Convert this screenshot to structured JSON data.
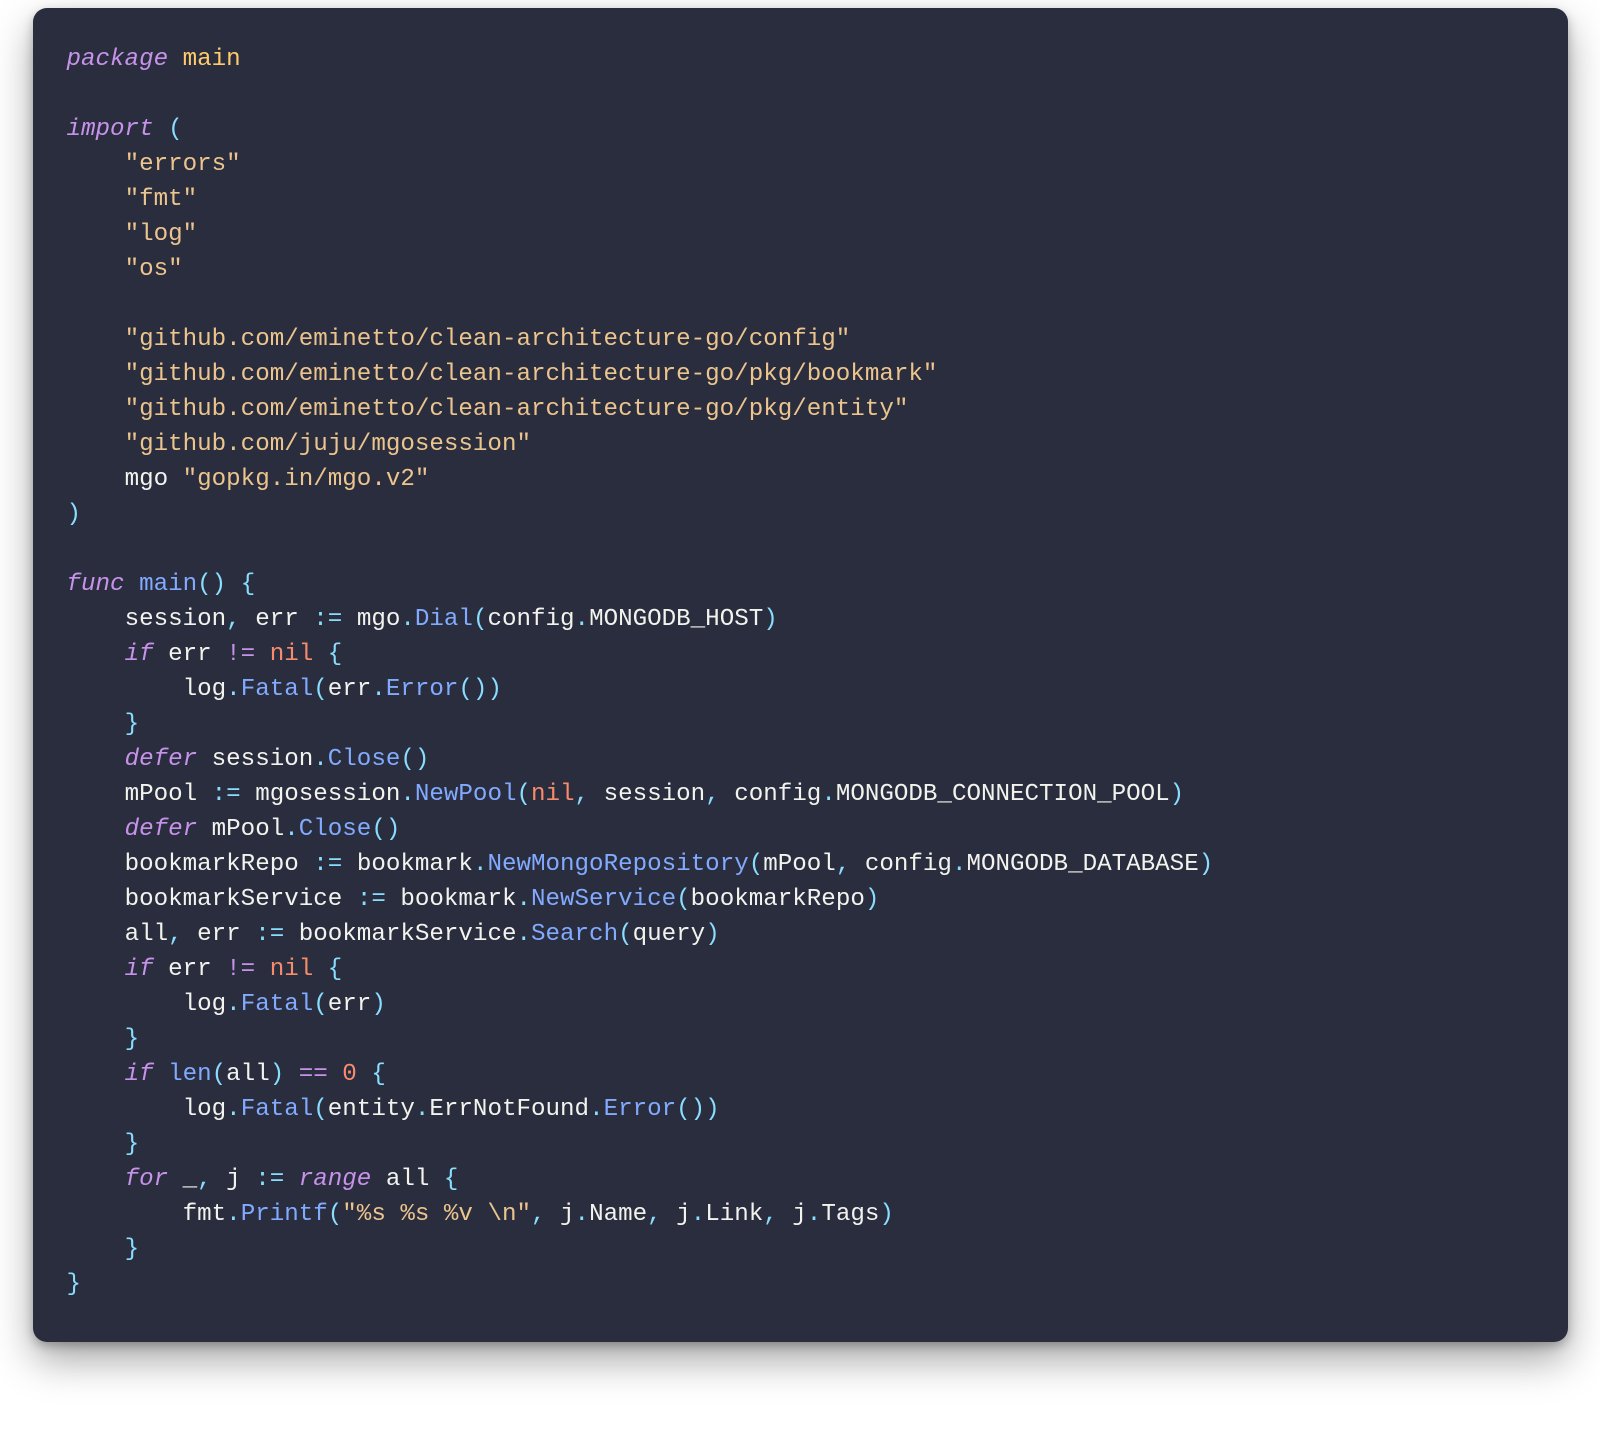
{
  "code": {
    "l1": {
      "a": "package",
      "b": " ",
      "c": "main"
    },
    "l2": "",
    "l3": {
      "a": "import",
      "b": " ",
      "c": "("
    },
    "l4": {
      "pad": "    ",
      "s": "\"errors\""
    },
    "l5": {
      "pad": "    ",
      "s": "\"fmt\""
    },
    "l6": {
      "pad": "    ",
      "s": "\"log\""
    },
    "l7": {
      "pad": "    ",
      "s": "\"os\""
    },
    "l8": "",
    "l9": {
      "pad": "    ",
      "s": "\"github.com/eminetto/clean-architecture-go/config\""
    },
    "l10": {
      "pad": "    ",
      "s": "\"github.com/eminetto/clean-architecture-go/pkg/bookmark\""
    },
    "l11": {
      "pad": "    ",
      "s": "\"github.com/eminetto/clean-architecture-go/pkg/entity\""
    },
    "l12": {
      "pad": "    ",
      "s": "\"github.com/juju/mgosession\""
    },
    "l13": {
      "pad": "    ",
      "a": "mgo",
      "b": " ",
      "s": "\"gopkg.in/mgo.v2\""
    },
    "l14": {
      "c": ")"
    },
    "l15": "",
    "l16": {
      "a": "func",
      "sp": " ",
      "b": "main",
      "c": "()",
      "sp2": " ",
      "d": "{"
    },
    "l17": {
      "pad": "    ",
      "t1": "session",
      "c1": ",",
      "sp1": " ",
      "t2": "err",
      "sp2": " ",
      "op": ":=",
      "sp3": " ",
      "t3": "mgo",
      "d1": ".",
      "f": "Dial",
      "p1": "(",
      "t4": "config",
      "d2": ".",
      "t5": "MONGODB_HOST",
      "p2": ")"
    },
    "l18": {
      "pad": "    ",
      "a": "if",
      "sp": " ",
      "t1": "err",
      "sp2": " ",
      "op": "!=",
      "sp3": " ",
      "t2": "nil",
      "sp4": " ",
      "b": "{"
    },
    "l19": {
      "pad": "        ",
      "t1": "log",
      "d1": ".",
      "f": "Fatal",
      "p1": "(",
      "t2": "err",
      "d2": ".",
      "f2": "Error",
      "p2": "())"
    },
    "l20": {
      "pad": "    ",
      "b": "}"
    },
    "l21": {
      "pad": "    ",
      "a": "defer",
      "sp": " ",
      "t1": "session",
      "d1": ".",
      "f": "Close",
      "p": "()"
    },
    "l22": {
      "pad": "    ",
      "t1": "mPool",
      "sp1": " ",
      "op": ":=",
      "sp2": " ",
      "t2": "mgosession",
      "d1": ".",
      "f": "NewPool",
      "p1": "(",
      "t3": "nil",
      "c1": ",",
      "sp3": " ",
      "t4": "session",
      "c2": ",",
      "sp4": " ",
      "t5": "config",
      "d2": ".",
      "t6": "MONGODB_CONNECTION_POOL",
      "p2": ")"
    },
    "l23": {
      "pad": "    ",
      "a": "defer",
      "sp": " ",
      "t1": "mPool",
      "d1": ".",
      "f": "Close",
      "p": "()"
    },
    "l24": {
      "pad": "    ",
      "t1": "bookmarkRepo",
      "sp1": " ",
      "op": ":=",
      "sp2": " ",
      "t2": "bookmark",
      "d1": ".",
      "f": "NewMongoRepository",
      "p1": "(",
      "t3": "mPool",
      "c1": ",",
      "sp3": " ",
      "t4": "config",
      "d2": ".",
      "t5": "MONGODB_DATABASE",
      "p2": ")"
    },
    "l25": {
      "pad": "    ",
      "t1": "bookmarkService",
      "sp1": " ",
      "op": ":=",
      "sp2": " ",
      "t2": "bookmark",
      "d1": ".",
      "f": "NewService",
      "p1": "(",
      "t3": "bookmarkRepo",
      "p2": ")"
    },
    "l26": {
      "pad": "    ",
      "t1": "all",
      "c1": ",",
      "sp1": " ",
      "t2": "err",
      "sp2": " ",
      "op": ":=",
      "sp3": " ",
      "t3": "bookmarkService",
      "d1": ".",
      "f": "Search",
      "p1": "(",
      "t4": "query",
      "p2": ")"
    },
    "l27": {
      "pad": "    ",
      "a": "if",
      "sp": " ",
      "t1": "err",
      "sp2": " ",
      "op": "!=",
      "sp3": " ",
      "t2": "nil",
      "sp4": " ",
      "b": "{"
    },
    "l28": {
      "pad": "        ",
      "t1": "log",
      "d1": ".",
      "f": "Fatal",
      "p1": "(",
      "t2": "err",
      "p2": ")"
    },
    "l29": {
      "pad": "    ",
      "b": "}"
    },
    "l30": {
      "pad": "    ",
      "a": "if",
      "sp": " ",
      "f": "len",
      "p1": "(",
      "t1": "all",
      "p2": ")",
      "sp2": " ",
      "op": "==",
      "sp3": " ",
      "n": "0",
      "sp4": " ",
      "b": "{"
    },
    "l31": {
      "pad": "        ",
      "t1": "log",
      "d1": ".",
      "f": "Fatal",
      "p1": "(",
      "t2": "entity",
      "d2": ".",
      "t3": "ErrNotFound",
      "d3": ".",
      "f2": "Error",
      "p2": "())"
    },
    "l32": {
      "pad": "    ",
      "b": "}"
    },
    "l33": {
      "pad": "    ",
      "a": "for",
      "sp": " ",
      "t1": "_",
      "c1": ",",
      "sp2": " ",
      "t2": "j",
      "sp3": " ",
      "op": ":=",
      "sp4": " ",
      "r": "range",
      "sp5": " ",
      "t3": "all",
      "sp6": " ",
      "b": "{"
    },
    "l34": {
      "pad": "        ",
      "t1": "fmt",
      "d1": ".",
      "f": "Printf",
      "p1": "(",
      "s": "\"%s %s %v \\n\"",
      "c1": ",",
      "sp1": " ",
      "t2": "j",
      "d2": ".",
      "t3": "Name",
      "c2": ",",
      "sp2": " ",
      "t4": "j",
      "d3": ".",
      "t5": "Link",
      "c3": ",",
      "sp3": " ",
      "t6": "j",
      "d4": ".",
      "t7": "Tags",
      "p2": ")"
    },
    "l35": {
      "pad": "    ",
      "b": "}"
    },
    "l36": {
      "b": "}"
    }
  }
}
